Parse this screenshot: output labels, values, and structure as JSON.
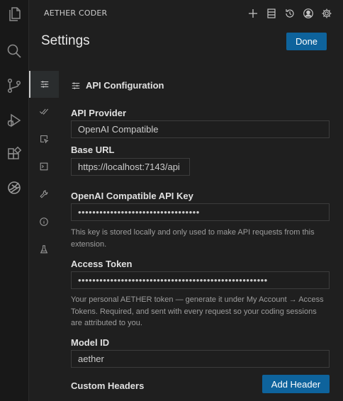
{
  "app": {
    "title": "AETHER CODER"
  },
  "header": {
    "settings_title": "Settings",
    "done_label": "Done",
    "actions": [
      "plus-icon",
      "history-list-icon",
      "history-icon",
      "account-icon",
      "gear-icon"
    ]
  },
  "activity_bar": [
    "files-icon",
    "search-icon",
    "source-control-icon",
    "run-debug-icon",
    "extensions-icon",
    "aether-logo-icon"
  ],
  "tabs": [
    {
      "icon": "sliders-icon",
      "active": true
    },
    {
      "icon": "check-all-icon",
      "active": false
    },
    {
      "icon": "browser-cursor-icon",
      "active": false
    },
    {
      "icon": "terminal-icon",
      "active": false
    },
    {
      "icon": "wrench-icon",
      "active": false
    },
    {
      "icon": "info-icon",
      "active": false
    },
    {
      "icon": "flask-icon",
      "active": false
    }
  ],
  "section": {
    "heading": "API Configuration"
  },
  "form": {
    "api_provider": {
      "label": "API Provider",
      "value": "OpenAI Compatible"
    },
    "base_url": {
      "label": "Base URL",
      "value": "https://localhost:7143/api"
    },
    "api_key": {
      "label": "OpenAI Compatible API Key",
      "value": "••••••••••••••••••••••••••••••••••",
      "help": "This key is stored locally and only used to make API requests from this extension."
    },
    "access_token": {
      "label": "Access Token",
      "value": "•••••••••••••••••••••••••••••••••••••••••••••••••••••",
      "help": "Your personal AETHER token — generate it under My Account → Access Tokens. Required, and sent with every request so your coding sessions are attributed to you."
    },
    "model_id": {
      "label": "Model ID",
      "value": "aether"
    },
    "custom_headers": {
      "label": "Custom Headers",
      "add_label": "Add Header"
    }
  },
  "colors": {
    "accent": "#0e639c",
    "background": "#1f1f1f",
    "activity_bar": "#181818"
  }
}
